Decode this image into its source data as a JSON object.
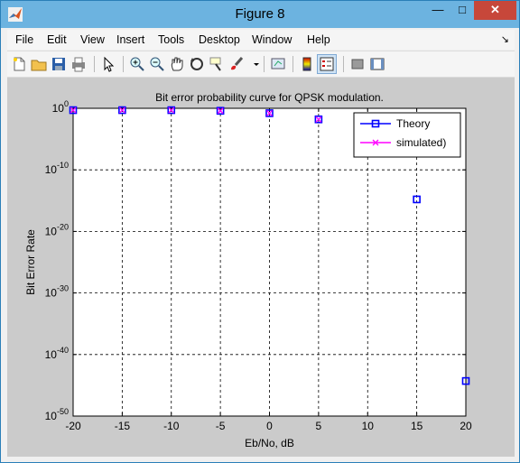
{
  "window": {
    "title": "Figure 8"
  },
  "menu": [
    "File",
    "Edit",
    "View",
    "Insert",
    "Tools",
    "Desktop",
    "Window",
    "Help"
  ],
  "toolbar": [
    "new-figure",
    "open-file",
    "save",
    "print",
    "edit-plot",
    "zoom-in",
    "zoom-out",
    "pan",
    "rotate-3d",
    "data-cursor",
    "brush",
    "link-plot",
    "colorbar",
    "legend",
    "hide-plot-tools",
    "show-plot-tools"
  ],
  "colors": {
    "theory": "#0000ff",
    "simulated": "#ff00ff",
    "close": "#c7473a",
    "titlebar": "#6cb3e0"
  },
  "chart_data": {
    "type": "line",
    "title": "Bit error probability curve for QPSK modulation.",
    "xlabel": "Eb/No, dB",
    "ylabel": "Bit Error Rate",
    "x_ticks": [
      "-20",
      "-15",
      "-10",
      "-5",
      "0",
      "5",
      "10",
      "15",
      "20"
    ],
    "y_tick_exponents": [
      "0",
      "-10",
      "-20",
      "-30",
      "-40",
      "-50"
    ],
    "y_tick_base": "10",
    "xlim": [
      -20,
      20
    ],
    "ylim_log10": [
      -50,
      0
    ],
    "yscale": "log",
    "grid": true,
    "legend_position": "top-right",
    "series": [
      {
        "name": "Theory",
        "marker": "square",
        "color": "#0000ff",
        "x": [
          -20,
          -15,
          -10,
          -5,
          0,
          5,
          15,
          20
        ],
        "log10_y": [
          -0.3,
          -0.3,
          -0.3,
          -0.4,
          -0.8,
          -1.8,
          -14.8,
          -44.3
        ]
      },
      {
        "name": "simulated)",
        "marker": "x",
        "color": "#ff00ff",
        "x": [
          -20,
          -15,
          -10,
          -5,
          0,
          5
        ],
        "log10_y": [
          -0.3,
          -0.3,
          -0.3,
          -0.4,
          -0.8,
          -1.8
        ]
      }
    ]
  }
}
